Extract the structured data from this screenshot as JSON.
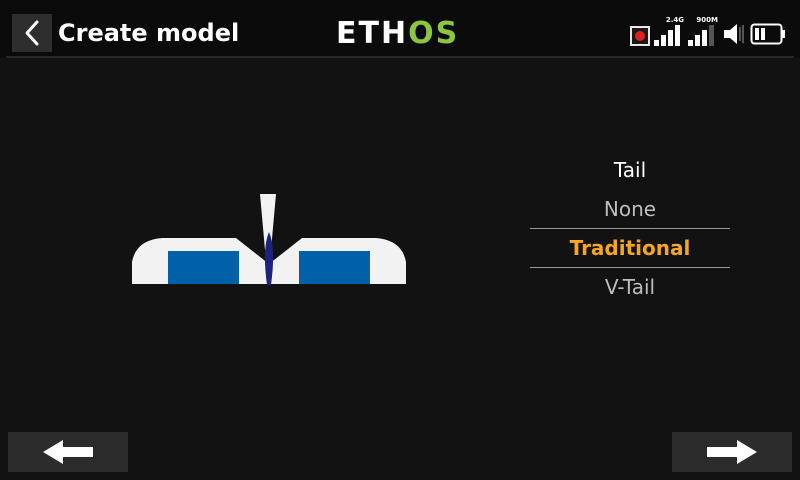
{
  "header": {
    "title": "Create model",
    "logo_left": "ETH",
    "logo_right": "OS"
  },
  "status": {
    "signal_24g_label": "2.4G",
    "signal_900m_label": "900M",
    "icons": [
      "record-icon",
      "signal-2.4g-icon",
      "signal-900m-icon",
      "speaker-icon",
      "battery-icon"
    ]
  },
  "tail_selector": {
    "label": "Tail",
    "options": [
      "None",
      "Traditional",
      "V-Tail"
    ],
    "selected": "Traditional"
  },
  "navigation": {
    "prev_icon": "arrow-left-icon",
    "next_icon": "arrow-right-icon"
  },
  "colors": {
    "accent": "#f6a623",
    "logo_green": "#8cc63f",
    "surface_blue": "#0060a8",
    "fuselage": "#1a237e"
  }
}
